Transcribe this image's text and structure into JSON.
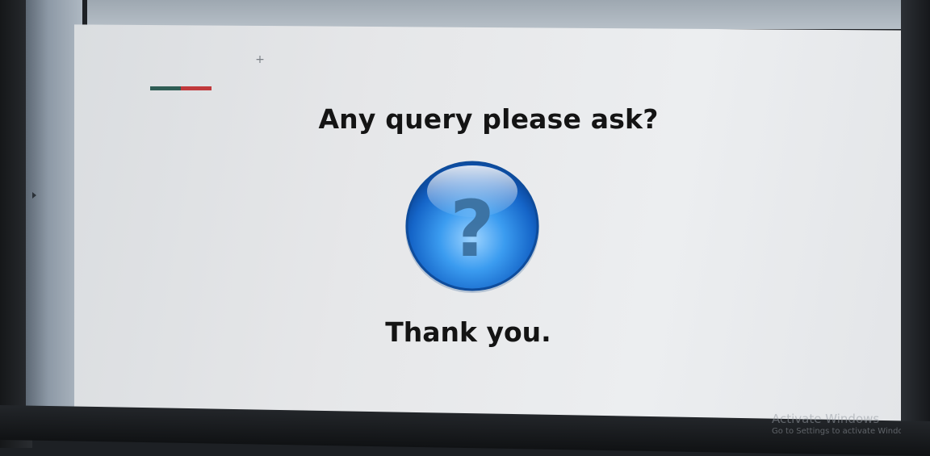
{
  "slide": {
    "title": "Any query please ask?",
    "closing": "Thank you."
  },
  "icons": {
    "question": "question-mark-icon",
    "cursor": "crosshair-cursor-icon"
  },
  "colors": {
    "accent_green": "#2f5d55",
    "accent_red": "#c0393c",
    "sphere_blue": "#1e7fe0"
  },
  "watermark": {
    "line1": "Activate Windows",
    "line2": "Go to Settings to activate Windows."
  }
}
